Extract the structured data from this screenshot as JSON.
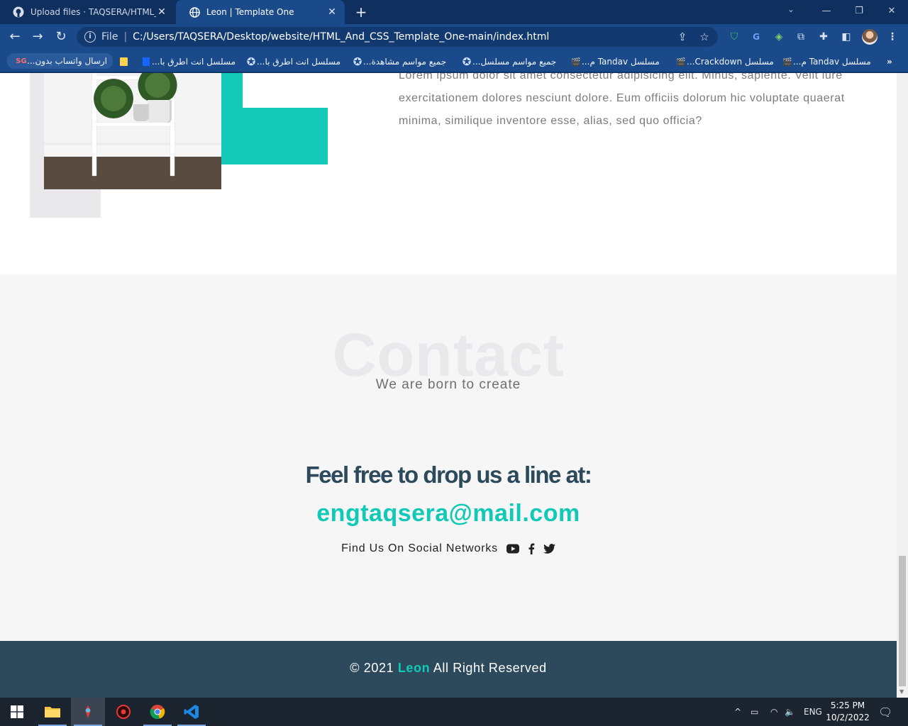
{
  "browser": {
    "tabs": [
      {
        "title": "Upload files · TAQSERA/HTML_An",
        "icon": "github-icon",
        "active": false
      },
      {
        "title": "Leon | Template One",
        "icon": "globe-icon",
        "active": true
      }
    ],
    "scheme_label": "File",
    "url": "C:/Users/TAQSERA/Desktop/website/HTML_And_CSS_Template_One-main/index.html",
    "bookmarks": [
      {
        "label": "ارسال واتساب بدون...",
        "icon": "sg-icon"
      },
      {
        "label": "",
        "icon": "folder-bookmark-icon"
      },
      {
        "label": "مسلسل انت اطرق با...",
        "icon": "bookmark-blue-icon"
      },
      {
        "label": "مسلسل انت اطرق با...",
        "icon": "film-reel-icon"
      },
      {
        "label": "جميع مواسم مشاهدة...",
        "icon": "film-reel-icon"
      },
      {
        "label": "جميع مواسم مسلسل...",
        "icon": "film-reel-icon"
      },
      {
        "label": "مسلسل Tandav م...",
        "icon": "clapper-icon"
      },
      {
        "label": "مسلسل Crackdown...",
        "icon": "clapper-icon"
      },
      {
        "label": "مسلسل Tandav م...",
        "icon": "clapper-icon"
      }
    ]
  },
  "about": {
    "paragraph": "Lorem ipsum dolor sit amet consectetur adipisicing elit. Minus, sapiente. Velit iure exercitationem dolores nesciunt dolore. Eum officiis dolorum hic voluptate quaerat minima, similique inventore esse, alias, sed quo officia?"
  },
  "contact": {
    "bg_word": "Contact",
    "subtitle": "We are born to create",
    "line": "Feel free to drop us a line at:",
    "email": "engtaqsera@mail.com",
    "social_label": "Find Us On Social Networks",
    "social_icons": [
      "youtube-icon",
      "facebook-icon",
      "twitter-icon"
    ]
  },
  "footer": {
    "prefix": "© 2021",
    "brand": "Leon",
    "suffix": "All Right Reserved"
  },
  "taskbar": {
    "lang": "ENG",
    "time": "5:25 PM",
    "date": "10/2/2022"
  },
  "colors": {
    "accent": "#12c9b7",
    "dark": "#2c4a5c",
    "chrome": "#1a4a8a"
  }
}
